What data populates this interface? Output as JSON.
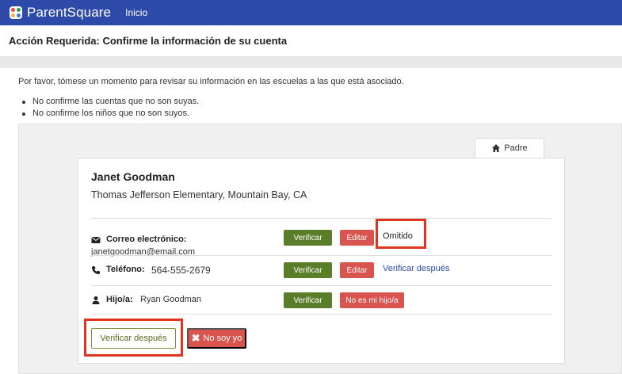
{
  "navbar": {
    "brand": "ParentSquare",
    "link_home": "Inicio",
    "logo_colors": [
      "#e94b3c",
      "#2d9c5a",
      "#f2b43a",
      "#3a7be0"
    ]
  },
  "page": {
    "title": "Acción Requerida: Confirme la información de su cuenta",
    "intro": "Por favor, tómese un momento para revisar su información en las escuelas a las que está asociado.",
    "rules": [
      "No confirme las cuentas que no son suyas.",
      "No confirme los niños que no son suyos."
    ]
  },
  "tab": {
    "label": "Padre",
    "icon": "home-icon"
  },
  "account": {
    "name": "Janet Goodman",
    "school": "Thomas Jefferson Elementary, Mountain Bay, CA",
    "email": {
      "icon": "envelope-icon",
      "label": "Correo electrónico:",
      "value": "janetgoodman@email.com",
      "verify_label": "Verificar",
      "edit_label": "Editar",
      "status": "Omitido"
    },
    "phone": {
      "icon": "phone-icon",
      "label": "Teléfono:",
      "value": "564-555-2679",
      "verify_label": "Verificar",
      "edit_label": "Editar",
      "later_link": "Verificar después"
    },
    "child": {
      "icon": "user-icon",
      "label": "Hijo/a:",
      "value": "Ryan Goodman",
      "verify_label": "Verificar",
      "not_mine_label": "No es mi hijo/a"
    }
  },
  "actions": {
    "verify_later": "Verificar después",
    "not_me": "No soy yo"
  },
  "colors": {
    "navbar": "#2d4aa8",
    "verify_green": "#5a7d2a",
    "danger_red": "#d9534f",
    "highlight": "#e0341e"
  }
}
